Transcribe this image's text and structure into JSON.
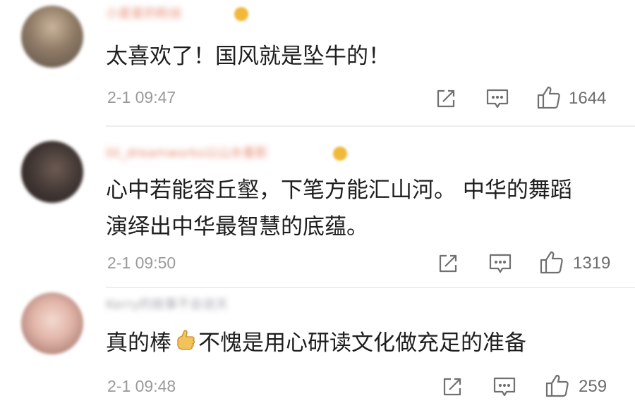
{
  "comments": [
    {
      "username": "小星星的粉丝",
      "text_lines": [
        "太喜欢了！国风就是坠牛的！"
      ],
      "time": "2-1 09:47",
      "likes": "1644"
    },
    {
      "username": "lili_dreamworks以山水看影",
      "text_lines": [
        "心中若能容丘壑，下笔方能汇山河。 中华的舞蹈",
        "演绎出中华最智慧的底蕴。"
      ],
      "time": "2-1 09:50",
      "likes": "1319"
    },
    {
      "username": "Kerry的故事不会说天",
      "text_before_emoji": "真的棒",
      "emoji": "thumbs-up",
      "text_after_emoji": "不愧是用心研读文化做充足的准备",
      "time": "2-1 09:48",
      "likes": "259"
    }
  ],
  "icons": {
    "share": "share-icon",
    "reply": "comment-icon",
    "like": "thumbs-up-icon"
  },
  "colors": {
    "username": "#e06a4a",
    "time": "#9a9a9a",
    "icon": "#707070"
  }
}
